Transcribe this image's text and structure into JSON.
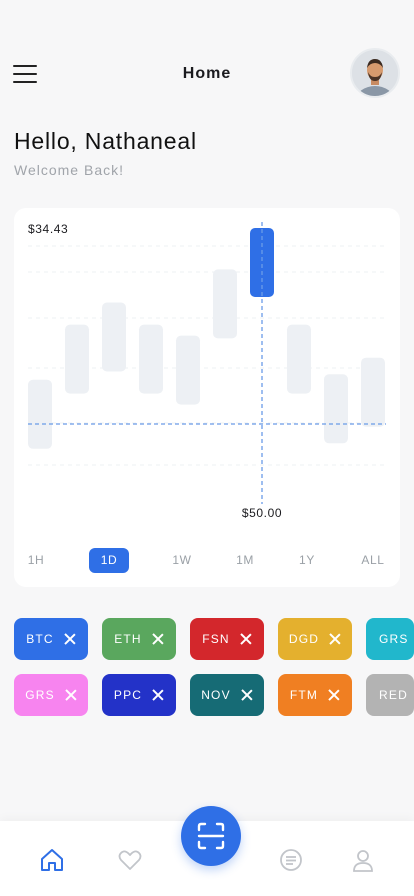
{
  "header": {
    "title": "Home"
  },
  "greeting": "Hello, Nathaneal",
  "welcome": "Welcome Back!",
  "chart": {
    "price_top": "$34.43",
    "price_bottom": "$50.00",
    "timeframes": [
      "1H",
      "1D",
      "1W",
      "1M",
      "1Y",
      "ALL"
    ],
    "active_timeframe": "1D"
  },
  "chart_data": {
    "type": "bar",
    "title": "",
    "candles": [
      {
        "low": 0.8,
        "high": 0.55
      },
      {
        "low": 0.6,
        "high": 0.35
      },
      {
        "low": 0.52,
        "high": 0.27
      },
      {
        "low": 0.6,
        "high": 0.35
      },
      {
        "low": 0.64,
        "high": 0.39
      },
      {
        "low": 0.4,
        "high": 0.15
      },
      {
        "low": 0.25,
        "high": 0.0
      },
      {
        "low": 0.6,
        "high": 0.35
      },
      {
        "low": 0.78,
        "high": 0.53
      },
      {
        "low": 0.72,
        "high": 0.47
      }
    ],
    "highlighted_index": 6,
    "annotations": [
      "$34.43",
      "$50.00"
    ]
  },
  "chips_row1": [
    {
      "label": "BTC",
      "color": "#2f6fe6"
    },
    {
      "label": "ETH",
      "color": "#5aa75e"
    },
    {
      "label": "FSN",
      "color": "#d3272c"
    },
    {
      "label": "DGD",
      "color": "#e4b02e"
    },
    {
      "label": "GRS",
      "color": "#21b7cc"
    }
  ],
  "chips_row2": [
    {
      "label": "GRS",
      "color": "#f784ef"
    },
    {
      "label": "PPC",
      "color": "#2332c8"
    },
    {
      "label": "NOV",
      "color": "#166b75"
    },
    {
      "label": "FTM",
      "color": "#f07f22"
    },
    {
      "label": "RED",
      "color": "#b3b3b3"
    }
  ],
  "nav": {
    "icons": [
      "home-icon",
      "heart-icon",
      "scan-icon",
      "chat-icon",
      "user-icon"
    ]
  }
}
